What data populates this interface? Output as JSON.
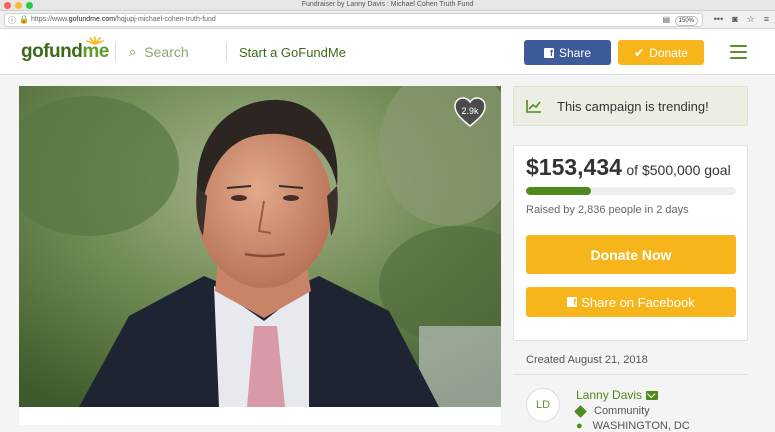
{
  "window": {
    "title": "Fundraiser by Lanny Davis : Michael Cohen Truth Fund",
    "dots": [
      "#fc5f57",
      "#fdbc2e",
      "#28c840"
    ]
  },
  "browser": {
    "url_prefix": "https://www.",
    "url_domain": "gofundme.com",
    "url_path": "/hqjupj-michael-cohen-truth-fund",
    "zoom": "150%",
    "icons": [
      "info-icon",
      "lock-icon",
      "reader-icon",
      "more-icon",
      "pocket-icon",
      "star-icon",
      "menu-icon"
    ]
  },
  "header": {
    "logo": {
      "go": "go",
      "fund": "fund",
      "me": "me"
    },
    "search_label": "Search",
    "start_label": "Start a GoFundMe",
    "share_label": "Share",
    "donate_label": "Donate",
    "colors": {
      "brand_green": "#4f8a1d",
      "facebook": "#3d5a9a",
      "donate": "#f7b51c"
    }
  },
  "hero": {
    "heart_count": "2.9k"
  },
  "trending": {
    "text": "This campaign is trending!"
  },
  "stats": {
    "raised": "$153,434",
    "goal_text": "of $500,000 goal",
    "progress_fraction": 0.31,
    "raised_by": "Raised by 2,836 people in 2 days",
    "donate_now_label": "Donate Now",
    "share_fb_label": "Share on Facebook"
  },
  "campaign": {
    "created": "Created August 21, 2018",
    "organizer_initials": "LD",
    "organizer_name": "Lanny Davis",
    "category": "Community",
    "location": "WASHINGTON, DC"
  }
}
